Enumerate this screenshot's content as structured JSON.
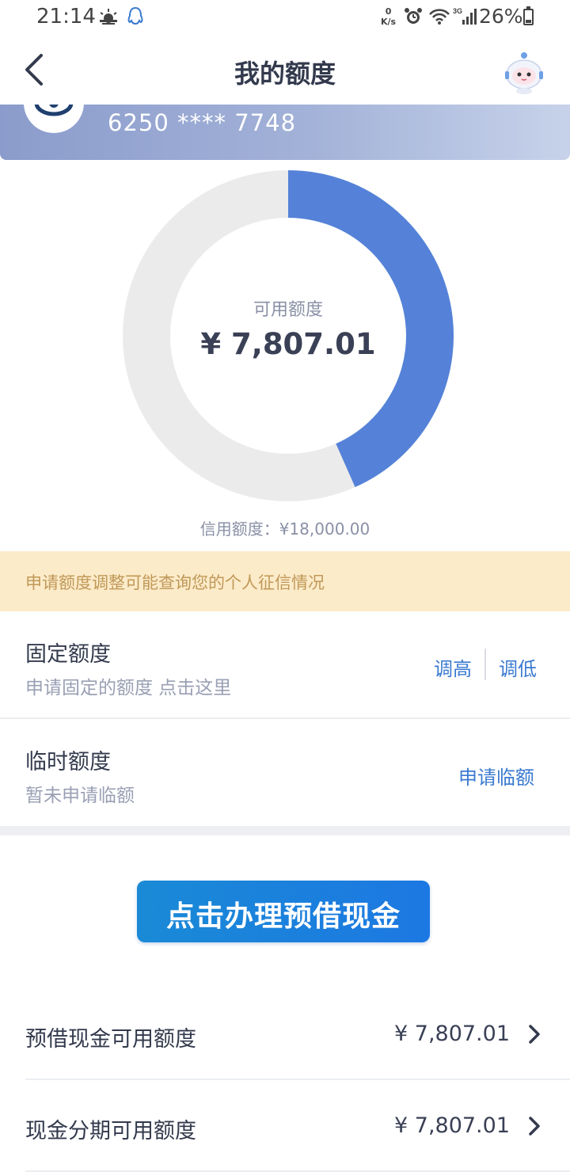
{
  "status_bar": {
    "time": "21:14",
    "speed_top": "0",
    "speed_unit": "K/s",
    "network": "3G",
    "battery": "26%"
  },
  "nav": {
    "title": "我的额度"
  },
  "card": {
    "number": "6250 **** 7748"
  },
  "donut": {
    "label": "可用额度",
    "amount": "¥ 7,807.01",
    "available_fraction": 0.4337,
    "available_color": "#5582d8",
    "rest_color": "#ebebeb"
  },
  "credit_limit": "信用额度：¥18,000.00",
  "notice": "申请额度调整可能查询您的个人征信情况",
  "fixed": {
    "title": "固定额度",
    "subtitle": "申请固定的额度 点击这里",
    "raise": "调高",
    "lower": "调低"
  },
  "temporary": {
    "title": "临时额度",
    "subtitle": "暂未申请临额",
    "apply": "申请临额"
  },
  "cta": {
    "label": "点击办理预借现金"
  },
  "amount_rows": [
    {
      "title": "预借现金可用额度",
      "value": "¥ 7,807.01"
    },
    {
      "title": "现金分期可用额度",
      "value": "¥ 7,807.01"
    }
  ],
  "colors": {
    "accent_link": "#3a7ad0",
    "notice_bg": "#fcebc9",
    "notice_text": "#c09858"
  }
}
